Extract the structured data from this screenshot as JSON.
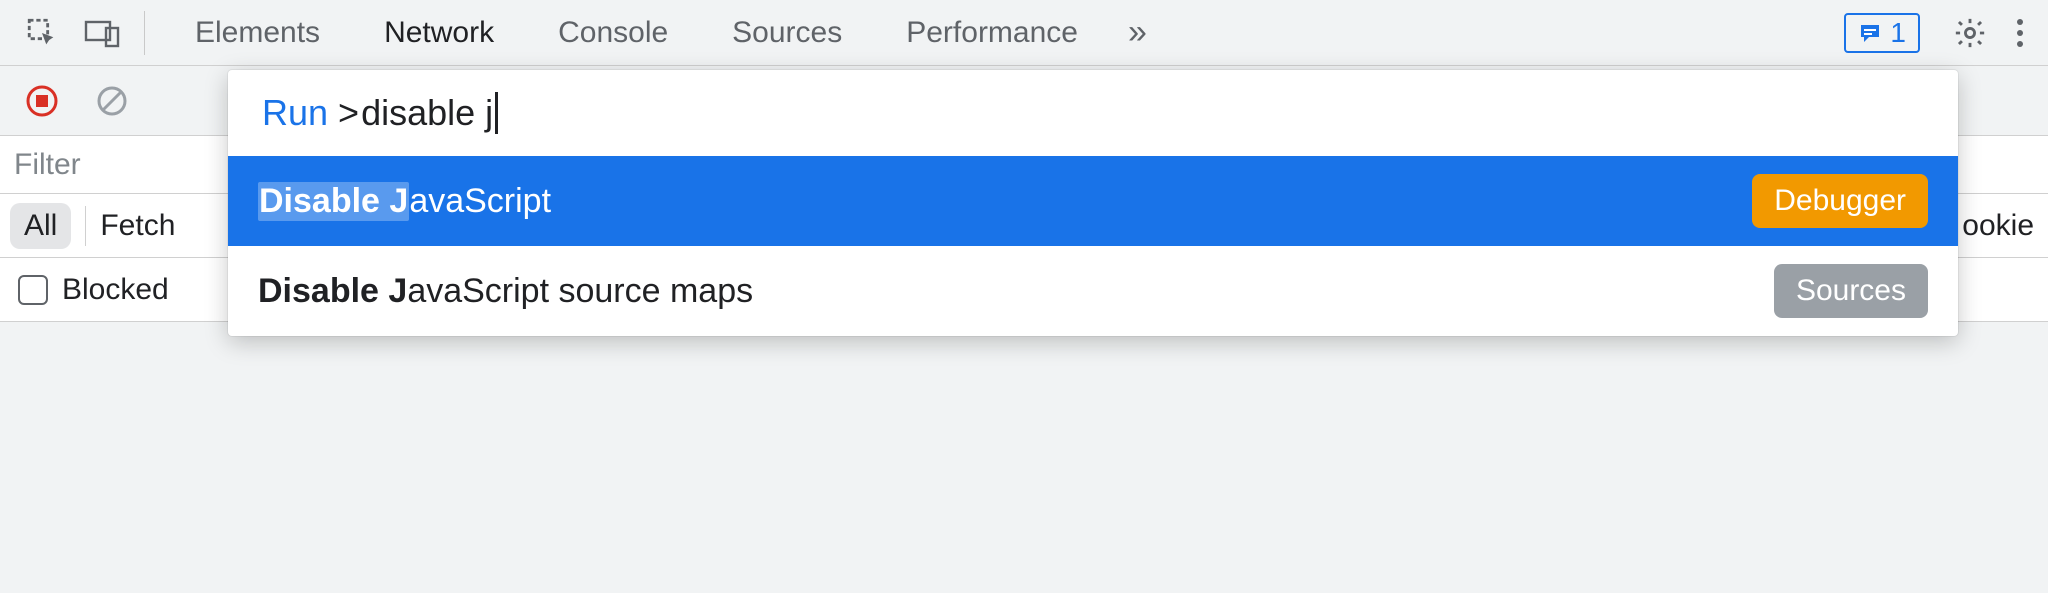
{
  "tabs": {
    "elements": "Elements",
    "network": "Network",
    "console": "Console",
    "sources": "Sources",
    "performance": "Performance",
    "overflow_glyph": "»"
  },
  "issues": {
    "count": "1"
  },
  "filter": {
    "placeholder": "Filter"
  },
  "chips": {
    "all": "All",
    "fetch": "Fetch",
    "cookie_tail": "ookie"
  },
  "blocked": {
    "label": "Blocked"
  },
  "command_menu": {
    "prefix": "Run",
    "gt": ">",
    "query": "disable j",
    "items": [
      {
        "match": "Disable J",
        "rest": "avaScript",
        "badge": "Debugger",
        "selected": true
      },
      {
        "match": "Disable J",
        "rest": "avaScript source maps",
        "badge": "Sources",
        "selected": false
      }
    ]
  }
}
